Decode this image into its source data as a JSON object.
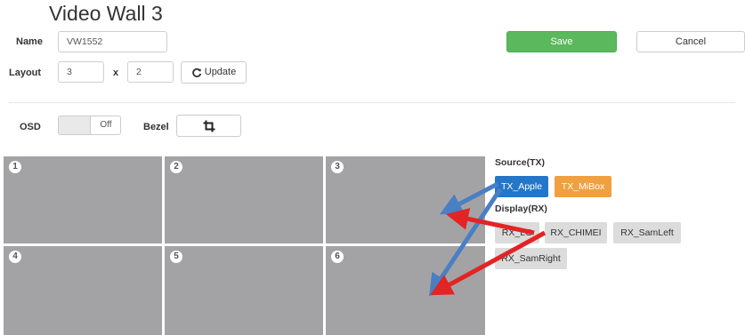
{
  "page": {
    "title": "Video Wall 3"
  },
  "form": {
    "name_label": "Name",
    "name_value": "VW1552",
    "layout_label": "Layout",
    "layout_cols": "3",
    "layout_x": "x",
    "layout_rows": "2",
    "update_label": "Update",
    "osd_label": "OSD",
    "osd_state": "Off",
    "bezel_label": "Bezel"
  },
  "actions": {
    "save_label": "Save",
    "cancel_label": "Cancel"
  },
  "wall": {
    "cells": [
      "1",
      "2",
      "3",
      "4",
      "5",
      "6"
    ]
  },
  "source": {
    "heading": "Source(TX)",
    "items": [
      "TX_Apple",
      "TX_MiBox"
    ]
  },
  "display": {
    "heading": "Display(RX)",
    "items": [
      "RX_LG",
      "RX_CHIMEI",
      "RX_SamLeft",
      "RX_SamRight"
    ]
  },
  "colors": {
    "save_green": "#5cb85c",
    "tx_selected_blue": "#2476c8",
    "tx_orange": "#f0a040",
    "arrow_blue": "#4a7fc4",
    "arrow_red": "#e32424",
    "cell_gray": "#a3a3a5"
  }
}
